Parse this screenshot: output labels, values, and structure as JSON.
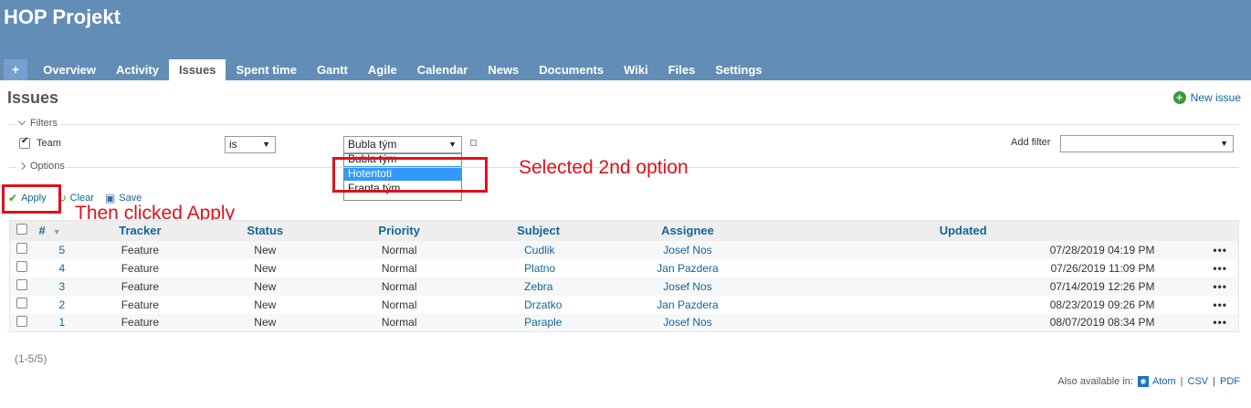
{
  "header": {
    "title": "HOP Projekt",
    "tabs": [
      {
        "label": "+",
        "selected": false
      },
      {
        "label": "Overview",
        "selected": false
      },
      {
        "label": "Activity",
        "selected": false
      },
      {
        "label": "Issues",
        "selected": true
      },
      {
        "label": "Spent time",
        "selected": false
      },
      {
        "label": "Gantt",
        "selected": false
      },
      {
        "label": "Agile",
        "selected": false
      },
      {
        "label": "Calendar",
        "selected": false
      },
      {
        "label": "News",
        "selected": false
      },
      {
        "label": "Documents",
        "selected": false
      },
      {
        "label": "Wiki",
        "selected": false
      },
      {
        "label": "Files",
        "selected": false
      },
      {
        "label": "Settings",
        "selected": false
      }
    ]
  },
  "page": {
    "title": "Issues",
    "new_issue": "New issue"
  },
  "filters": {
    "legend": "Filters",
    "team_label": "Team",
    "team_checked": true,
    "operator": "is",
    "value": "Bubla tým",
    "options": [
      "Bubla tým",
      "Hotentoti",
      "Franta tým"
    ],
    "selected_option_index": 1,
    "add_filter_label": "Add filter",
    "add_filter_value": ""
  },
  "options": {
    "legend": "Options"
  },
  "actions": {
    "apply": "Apply",
    "clear": "Clear",
    "save": "Save"
  },
  "annotations": {
    "selected_note": "Selected 2nd option",
    "apply_note": "Then clicked Apply",
    "color": "#e0101d"
  },
  "table": {
    "columns": [
      "#",
      "Tracker",
      "Status",
      "Priority",
      "Subject",
      "Assignee",
      "Updated"
    ],
    "rows": [
      {
        "id": "5",
        "tracker": "Feature",
        "status": "New",
        "priority": "Normal",
        "subject": "Cudlik",
        "assignee": "Josef Nos",
        "updated": "07/28/2019 04:19 PM"
      },
      {
        "id": "4",
        "tracker": "Feature",
        "status": "New",
        "priority": "Normal",
        "subject": "Platno",
        "assignee": "Jan Pazdera",
        "updated": "07/26/2019 11:09 PM"
      },
      {
        "id": "3",
        "tracker": "Feature",
        "status": "New",
        "priority": "Normal",
        "subject": "Zebra",
        "assignee": "Josef Nos",
        "updated": "07/14/2019 12:26 PM"
      },
      {
        "id": "2",
        "tracker": "Feature",
        "status": "New",
        "priority": "Normal",
        "subject": "Drzatko",
        "assignee": "Jan Pazdera",
        "updated": "08/23/2019 09:26 PM"
      },
      {
        "id": "1",
        "tracker": "Feature",
        "status": "New",
        "priority": "Normal",
        "subject": "Paraple",
        "assignee": "Josef Nos",
        "updated": "08/07/2019 08:34 PM"
      }
    ]
  },
  "footer": {
    "count": "(1-5/5)",
    "also_available": "Also available in:",
    "formats": [
      "Atom",
      "CSV",
      "PDF"
    ]
  },
  "colors": {
    "header_bg": "#628db6",
    "link": "#116699"
  }
}
